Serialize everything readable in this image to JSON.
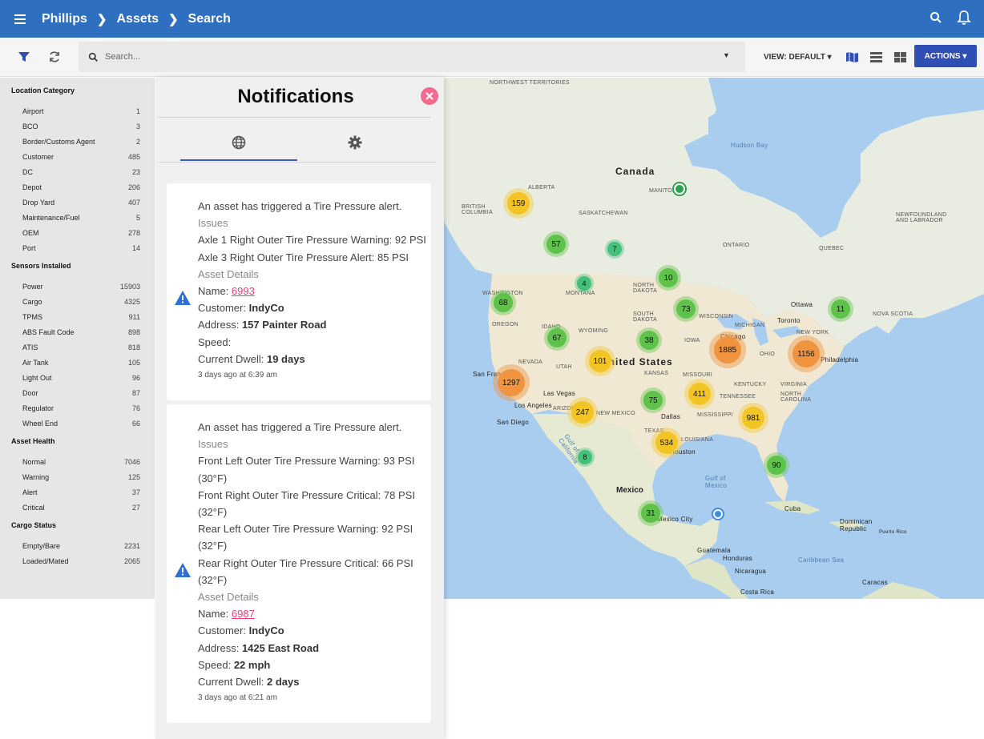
{
  "header": {
    "breadcrumb": [
      "Phillips",
      "Assets",
      "Search"
    ]
  },
  "toolbar": {
    "search_placeholder": "Search...",
    "view_label": "VIEW: DEFAULT",
    "actions_label": "ACTIONS"
  },
  "sidebar": {
    "sections": [
      {
        "title": "Location Category",
        "items": [
          {
            "label": "Airport",
            "count": "1"
          },
          {
            "label": "BCO",
            "count": "3"
          },
          {
            "label": "Border/Customs Agent",
            "count": "2"
          },
          {
            "label": "Customer",
            "count": "485"
          },
          {
            "label": "DC",
            "count": "23"
          },
          {
            "label": "Depot",
            "count": "206"
          },
          {
            "label": "Drop Yard",
            "count": "407"
          },
          {
            "label": "Maintenance/Fuel",
            "count": "5"
          },
          {
            "label": "OEM",
            "count": "278"
          },
          {
            "label": "Port",
            "count": "14"
          }
        ]
      },
      {
        "title": "Sensors Installed",
        "items": [
          {
            "label": "Power",
            "count": "15903"
          },
          {
            "label": "Cargo",
            "count": "4325"
          },
          {
            "label": "TPMS",
            "count": "911"
          },
          {
            "label": "ABS Fault Code",
            "count": "898"
          },
          {
            "label": "ATIS",
            "count": "818"
          },
          {
            "label": "Air Tank",
            "count": "105"
          },
          {
            "label": "Light Out",
            "count": "96"
          },
          {
            "label": "Door",
            "count": "87"
          },
          {
            "label": "Regulator",
            "count": "76"
          },
          {
            "label": "Wheel End",
            "count": "66"
          }
        ]
      },
      {
        "title": "Asset Health",
        "items": [
          {
            "label": "Normal",
            "count": "7046"
          },
          {
            "label": "Warning",
            "count": "125"
          },
          {
            "label": "Alert",
            "count": "37"
          },
          {
            "label": "Critical",
            "count": "27"
          }
        ]
      },
      {
        "title": "Cargo Status",
        "items": [
          {
            "label": "Empty/Bare",
            "count": "2231"
          },
          {
            "label": "Loaded/Mated",
            "count": "2065"
          }
        ]
      }
    ]
  },
  "notifications": {
    "title": "Notifications",
    "cards": [
      {
        "headline": "An asset has triggered a Tire Pressure alert.",
        "issues_label": "Issues",
        "issues": [
          "Axle 1 Right Outer Tire Pressure Warning: 92 PSI",
          "Axle 3 Right Outer Tire Pressure Alert: 85 PSI"
        ],
        "details_label": "Asset Details",
        "name_label": "Name:",
        "name_value": "6993",
        "customer_label": "Customer:",
        "customer_value": "IndyCo",
        "address_label": "Address:",
        "address_value": "157 Painter Road",
        "speed_label": "Speed:",
        "speed_value": "",
        "dwell_label": "Current Dwell:",
        "dwell_value": "19 days",
        "time": "3 days ago at 6:39 am"
      },
      {
        "headline": "An asset has triggered a Tire Pressure alert.",
        "issues_label": "Issues",
        "issues": [
          "Front Left Outer Tire Pressure Warning: 93 PSI",
          "(30°F)",
          "Front Right Outer Tire Pressure Critical: 78 PSI",
          "(32°F)",
          "Rear Left Outer Tire Pressure Warning: 92 PSI",
          "(32°F)",
          "Rear Right Outer Tire Pressure Critical: 66 PSI",
          "(32°F)"
        ],
        "details_label": "Asset Details",
        "name_label": "Name:",
        "name_value": "6987",
        "customer_label": "Customer:",
        "customer_value": "IndyCo",
        "address_label": "Address:",
        "address_value": "1425 East Road",
        "speed_label": "Speed:",
        "speed_value": "22 mph",
        "dwell_label": "Current Dwell:",
        "dwell_value": "2 days",
        "time": "3 days ago at 6:21 am"
      }
    ]
  },
  "map": {
    "clusters": [
      "159",
      "57",
      "7",
      "4",
      "10",
      "68",
      "73",
      "11",
      "67",
      "38",
      "1885",
      "1156",
      "101",
      "1297",
      "75",
      "411",
      "247",
      "981",
      "534",
      "8",
      "90",
      "31"
    ],
    "labels": {
      "canada": "Canada",
      "us": "United States",
      "mexico": "Mexico",
      "hudson": "Hudson Bay",
      "gulf": "Gulf of Mexico",
      "nwt": "NORTHWEST TERRITORIES",
      "alberta": "ALBERTA",
      "bc": "BRITISH COLUMBIA",
      "sask": "SASKATCHEWAN",
      "manitoba": "MANITOBA",
      "ontario": "ONTARIO",
      "quebec": "QUEBEC",
      "newfoundland": "NEWFOUNDLAND AND LABRADOR",
      "montana": "MONTANA",
      "ndakota": "NORTH DAKOTA",
      "washington": "WASHINGTON",
      "oregon": "OREGON",
      "idaho": "IDAHO",
      "wyoming": "WYOMING",
      "nevada": "NEVADA",
      "utah": "UTAH",
      "sdakota": "SOUTH DAKOTA",
      "iowa": "IOWA",
      "kansas": "KANSAS",
      "missouri": "MISSOURI",
      "wisconsin": "WISCONSIN",
      "michigan": "MICHIGAN",
      "newyork": "NEW YORK",
      "ohio": "OHIO",
      "kentucky": "KENTUCKY",
      "tennessee": "TENNESSEE",
      "ncarolina": "NORTH CAROLINA",
      "virginia": "VIRGINIA",
      "louisiana": "LOUISIANA",
      "texas": "TEXAS",
      "newmexico": "NEW MEXICO",
      "arizona": "ARIZONA",
      "mississippi": "MISSISSIPPI",
      "sanfrancisco": "San Francisco",
      "losangeles": "Los Angeles",
      "sandiego": "San Diego",
      "lasvegas": "Las Vegas",
      "dallas": "Dallas",
      "houston": "Houston",
      "chicago": "Chicago",
      "toronto": "Toronto",
      "ottawa": "Ottawa",
      "philadelphia": "Philadelphia",
      "mexicocity": "Mexico City",
      "cuba": "Cuba",
      "dominican": "Dominican Republic",
      "puertorico": "Puerto Rico",
      "guatemala": "Guatemala",
      "honduras": "Honduras",
      "nicaragua": "Nicaragua",
      "costarica": "Costa Rica",
      "caribbean": "Caribbean Sea",
      "caracas": "Caracas",
      "gulfcal": "Gulf of California",
      "novascotia": "NOVA SCOTIA"
    }
  }
}
